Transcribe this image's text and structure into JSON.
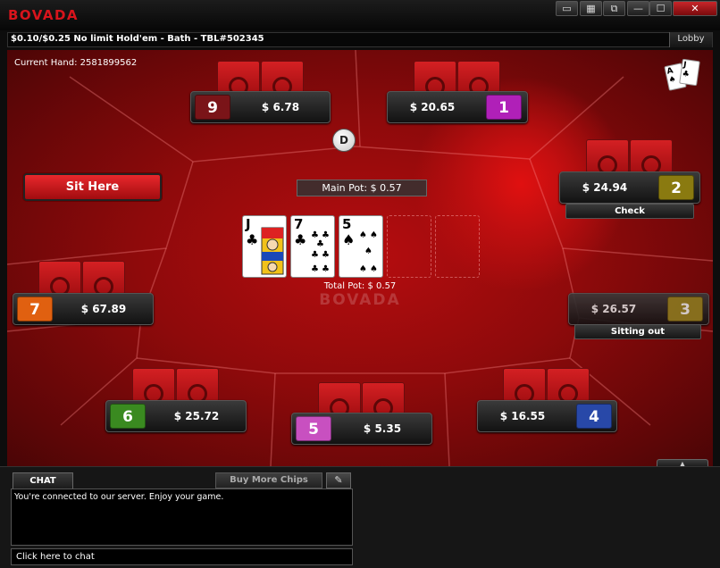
{
  "window": {
    "logo": "BOVADA",
    "buttons": {
      "layout1": "▭",
      "layout2": "▦",
      "layout3": "⧉",
      "minimize": "—",
      "maximize": "☐",
      "close": "✕"
    }
  },
  "infobar": {
    "table_info": "$0.10/$0.25 No limit Hold'em - Bath - TBL#502345",
    "lobby_label": "Lobby"
  },
  "table": {
    "current_hand": "Current Hand: 2581899562",
    "dealer_label": "D",
    "main_pot": "Main Pot: $ 0.57",
    "total_pot": "Total Pot: $ 0.57",
    "felt_logo": "BOVADA",
    "sit_here_label": "Sit Here",
    "board": [
      {
        "rank": "J",
        "suit": "♣"
      },
      {
        "rank": "7",
        "suit": "♣"
      },
      {
        "rank": "5",
        "suit": "♠"
      }
    ],
    "corner_cards": [
      {
        "rank": "A",
        "suit": "♠"
      },
      {
        "rank": "J",
        "suit": "♣"
      }
    ]
  },
  "seats": [
    {
      "number": "9",
      "amount": "$ 6.78",
      "color": "#7a1418",
      "status": ""
    },
    {
      "number": "1",
      "amount": "$ 20.65",
      "color": "#b020b8",
      "status": ""
    },
    {
      "number": "2",
      "amount": "$ 24.94",
      "color": "#8a7a10",
      "status": "Check"
    },
    {
      "number": "3",
      "amount": "$ 26.57",
      "color": "#8a7a20",
      "status": "Sitting out"
    },
    {
      "number": "4",
      "amount": "$ 16.55",
      "color": "#2848a8",
      "status": ""
    },
    {
      "number": "5",
      "amount": "$ 5.35",
      "color": "#c850c0",
      "status": ""
    },
    {
      "number": "6",
      "amount": "$ 25.72",
      "color": "#3a8a20",
      "status": ""
    },
    {
      "number": "7",
      "amount": "$ 67.89",
      "color": "#e06010",
      "status": ""
    }
  ],
  "chat": {
    "tab_label": "CHAT",
    "buy_chips_label": "Buy More Chips",
    "messages": [
      "You're connected to our server. Enjoy your game."
    ],
    "input_placeholder": "Click here to chat"
  }
}
